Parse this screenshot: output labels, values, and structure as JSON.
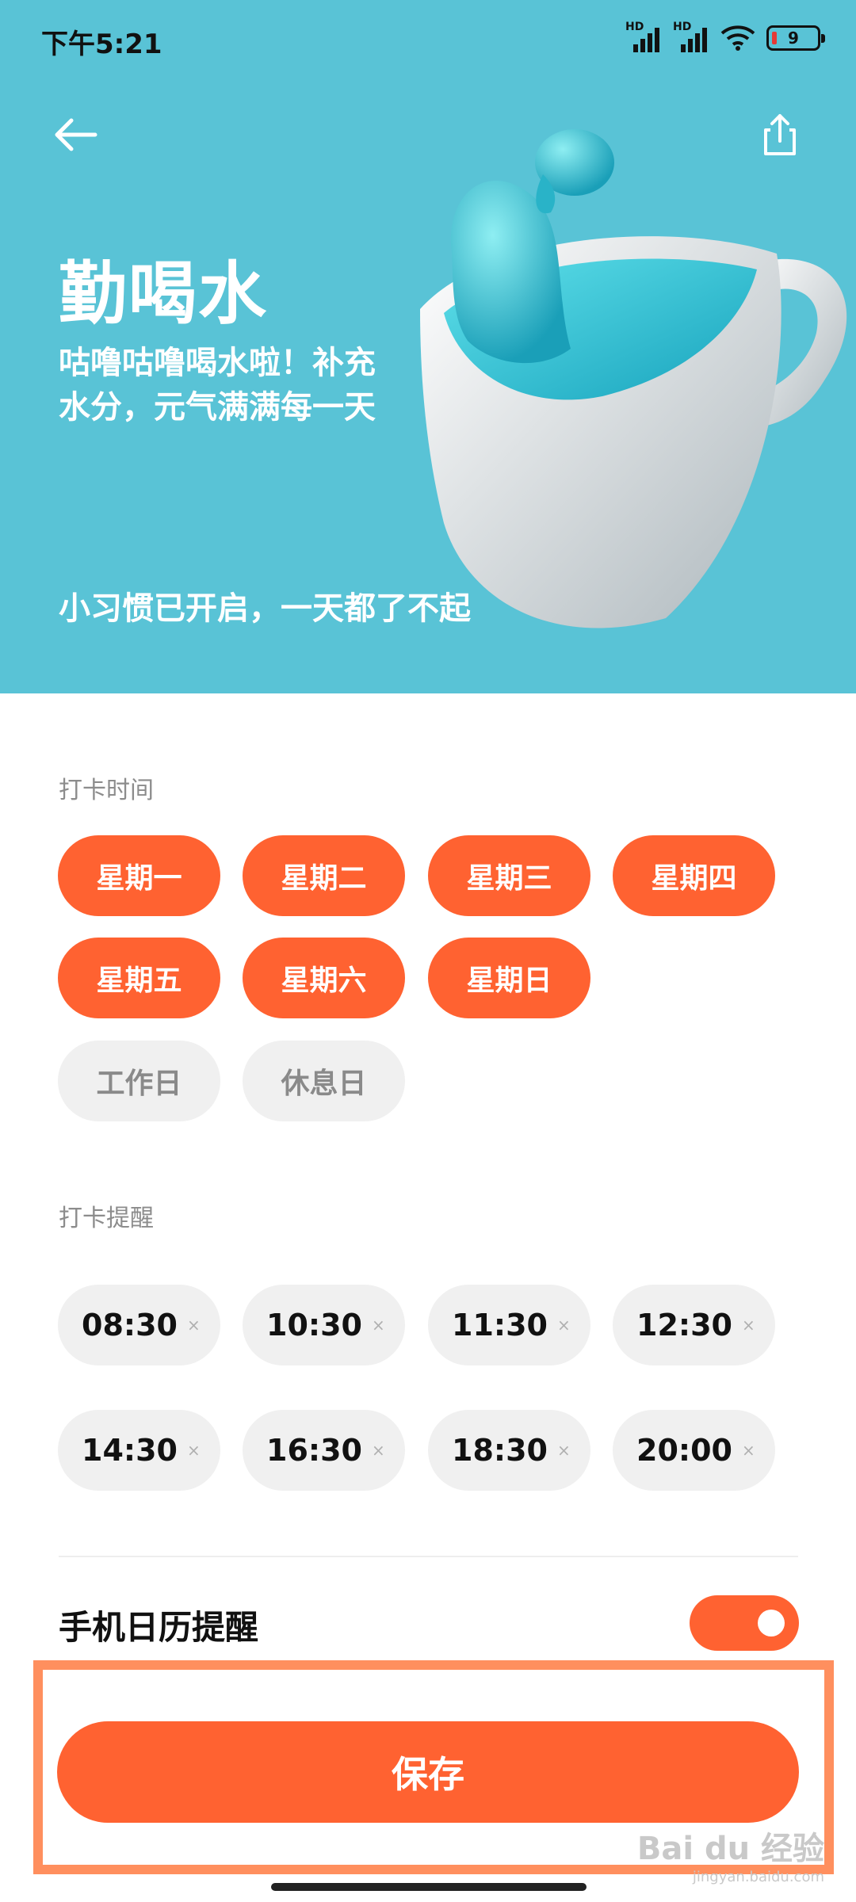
{
  "status_bar": {
    "time": "下午5:21",
    "signal_label_1": "HD",
    "signal_label_2": "HD",
    "battery_level": "9",
    "icons": [
      "signal-icon",
      "signal-icon",
      "wifi-icon",
      "battery-icon"
    ]
  },
  "header": {
    "title": "勤喝水",
    "subtitle": "咕噜咕噜喝水啦！补充水分，元气满满每一天",
    "note": "小习惯已开启，一天都了不起",
    "back_icon": "back-arrow-icon",
    "share_icon": "share-icon",
    "background_color": "#59c3d6"
  },
  "checkin_days": {
    "label": "打卡时间",
    "days": [
      {
        "label": "星期一",
        "selected": true
      },
      {
        "label": "星期二",
        "selected": true
      },
      {
        "label": "星期三",
        "selected": true
      },
      {
        "label": "星期四",
        "selected": true
      },
      {
        "label": "星期五",
        "selected": true
      },
      {
        "label": "星期六",
        "selected": true
      },
      {
        "label": "星期日",
        "selected": true
      },
      {
        "label": "工作日",
        "selected": false
      },
      {
        "label": "休息日",
        "selected": false
      }
    ]
  },
  "reminders": {
    "label": "打卡提醒",
    "times": [
      "08:30",
      "10:30",
      "11:30",
      "12:30",
      "14:30",
      "16:30",
      "18:30",
      "20:00"
    ],
    "remove_symbol": "×"
  },
  "calendar": {
    "label": "手机日历提醒",
    "enabled": true
  },
  "footer": {
    "save_label": "保存",
    "watermark_logo": "Bai du 经验",
    "watermark_url": "jingyan.baidu.com"
  },
  "colors": {
    "accent": "#ff6231",
    "chip_inactive": "#f0f0f0",
    "highlight_frame": "#ff8f5e"
  }
}
